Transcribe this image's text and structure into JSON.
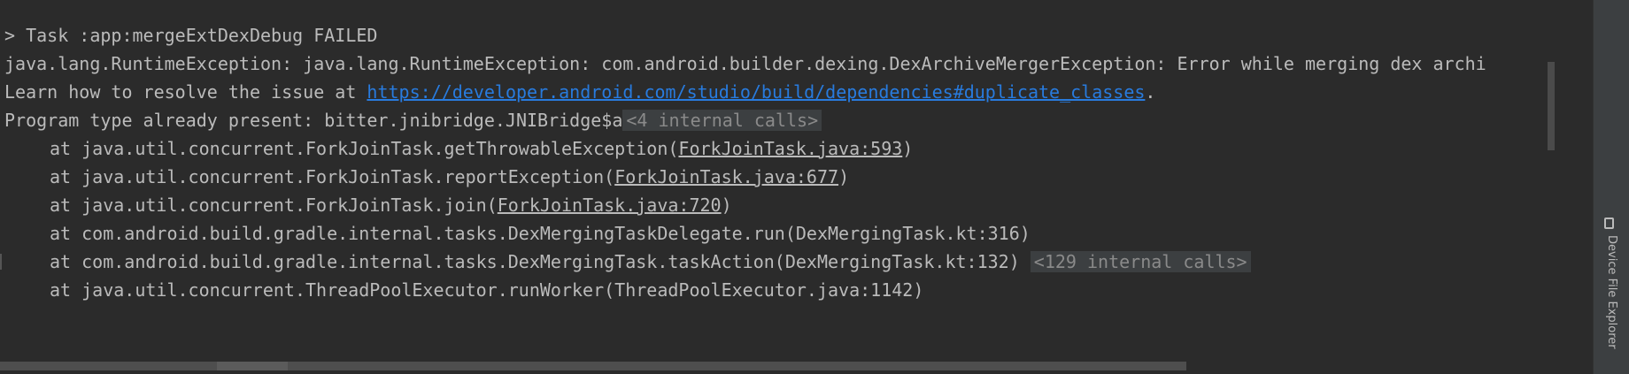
{
  "console": {
    "task_line": "> Task :app:mergeExtDexDebug FAILED",
    "exception_line": "java.lang.RuntimeException: java.lang.RuntimeException: com.android.builder.dexing.DexArchiveMergerException: Error while merging dex archi",
    "learn_prefix": "Learn how to resolve the issue at ",
    "learn_link": "https://developer.android.com/studio/build/dependencies#duplicate_classes",
    "learn_suffix": ".",
    "program_line": "Program type already present: bitter.jnibridge.JNIBridge$a",
    "program_chip": "<4 internal calls>",
    "stack": [
      {
        "prefix": "at java.util.concurrent.ForkJoinTask.getThrowableException(",
        "source": "ForkJoinTask.java:593",
        "suffix": ")"
      },
      {
        "prefix": "at java.util.concurrent.ForkJoinTask.reportException(",
        "source": "ForkJoinTask.java:677",
        "suffix": ")"
      },
      {
        "prefix": "at java.util.concurrent.ForkJoinTask.join(",
        "source": "ForkJoinTask.java:720",
        "suffix": ")"
      },
      {
        "text": "at com.android.build.gradle.internal.tasks.DexMergingTaskDelegate.run(DexMergingTask.kt:316)"
      },
      {
        "text": "at com.android.build.gradle.internal.tasks.DexMergingTask.taskAction(DexMergingTask.kt:132)",
        "chip": "<129 internal calls>"
      },
      {
        "text": "at java.util.concurrent.ThreadPoolExecutor.runWorker(ThreadPoolExecutor.java:1142)"
      }
    ]
  },
  "sidebar": {
    "device_file_explorer_label": "Device File Explorer",
    "device_file_explorer_icon": "device-icon"
  }
}
